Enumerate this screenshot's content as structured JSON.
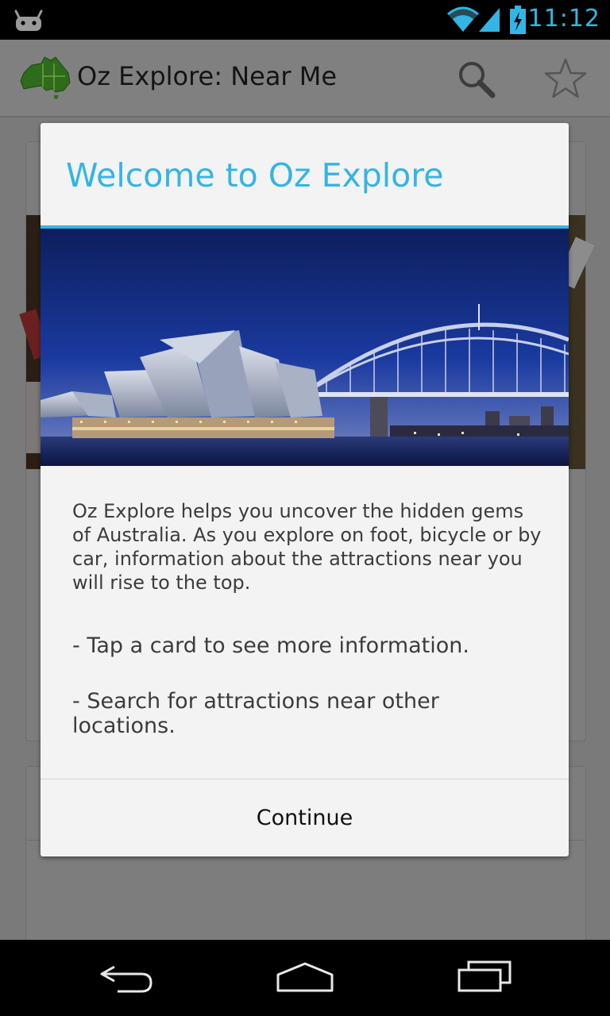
{
  "status_bar": {
    "time": "11:12",
    "icons": [
      "android-icon",
      "wifi-icon",
      "signal-icon",
      "battery-charging-icon"
    ],
    "accent_color": "#33b5e5"
  },
  "action_bar": {
    "title": "Oz Explore: Near Me",
    "logo_icon": "australia-map-icon",
    "actions": [
      "search-icon",
      "star-icon"
    ]
  },
  "dialog": {
    "title": "Welcome to Oz Explore",
    "title_color": "#33b5e5",
    "body": "Oz Explore helps you uncover the hidden gems of Australia. As you explore on foot, bicycle or by car, information about the attractions near you will rise to the top.",
    "tips": [
      "- Tap a card to see more information.",
      "- Search for attractions near other locations."
    ],
    "button_label": "Continue"
  },
  "nav_bar": {
    "buttons": [
      "back-icon",
      "home-icon",
      "recents-icon"
    ]
  }
}
